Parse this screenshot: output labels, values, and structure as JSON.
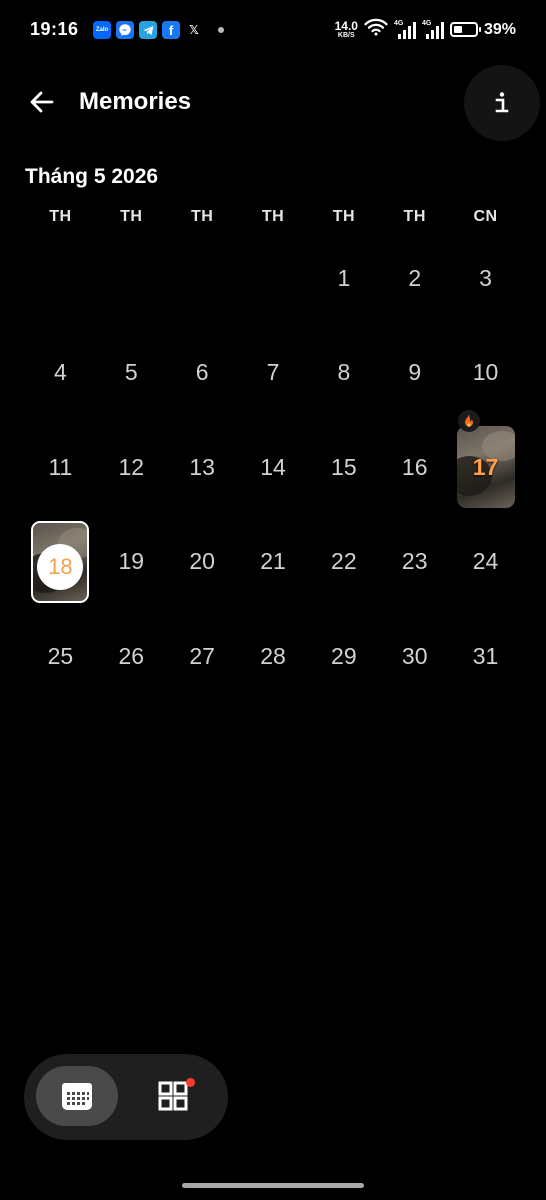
{
  "status_bar": {
    "time": "19:16",
    "notification_apps": [
      "Zalo",
      "messenger-icon",
      "telegram-icon",
      "f",
      "𝕏"
    ],
    "net_speed_value": "14.0",
    "net_speed_unit": "KB/S",
    "signal_1": "4G",
    "signal_2": "4G",
    "battery_level": 0.39,
    "battery_percent": "39%"
  },
  "header": {
    "title": "Memories",
    "info_label": "i"
  },
  "calendar": {
    "month_label": "Tháng 5 2026",
    "weekdays": [
      "TH",
      "TH",
      "TH",
      "TH",
      "TH",
      "TH",
      "CN"
    ],
    "weeks": [
      [
        "",
        "",
        "",
        "",
        "1",
        "2",
        "3"
      ],
      [
        "4",
        "5",
        "6",
        "7",
        "8",
        "9",
        "10"
      ],
      [
        "11",
        "12",
        "13",
        "14",
        "15",
        "16",
        "17"
      ],
      [
        "18",
        "19",
        "20",
        "21",
        "22",
        "23",
        "24"
      ],
      [
        "25",
        "26",
        "27",
        "28",
        "29",
        "30",
        "31"
      ]
    ],
    "memory_days": [
      "17",
      "18"
    ],
    "streak_day": "17",
    "today": "18",
    "memory_number_color": "#ffa048"
  },
  "bottom_nav": {
    "calendar_icon": "calendar-icon",
    "grid_icon": "grid-icon",
    "badge_color": "#ff3b30"
  }
}
